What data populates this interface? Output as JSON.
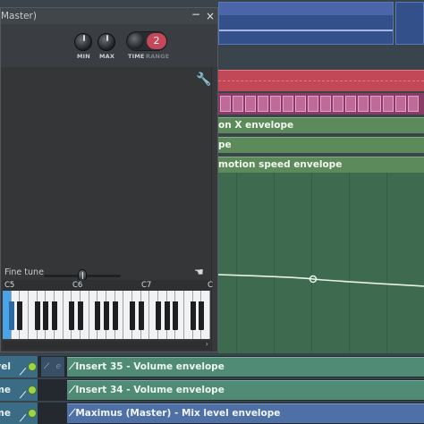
{
  "plugin": {
    "title": "Master)",
    "minimize_symbol": "−",
    "close_symbol": "×",
    "knobs": {
      "min_label": "MIN",
      "max_label": "MAX",
      "time_label": "TIME",
      "range_label": "RANGE",
      "time_value": "2"
    },
    "settings_icon": "wrench-icon",
    "fine_tune_label": "Fine tune",
    "keyboard": {
      "octave_labels": [
        "C5",
        "C6",
        "C7",
        "C"
      ],
      "highlighted_key": "C5"
    }
  },
  "playlist": {
    "envelope_lanes": [
      "on X envelope",
      "pe",
      "motion speed envelope"
    ],
    "tracks": [
      {
        "header": "vel",
        "clip": "Insert 35 - Volume envelope",
        "mid_letter": "e"
      },
      {
        "header": "me",
        "clip": "Insert 34 - Volume envelope"
      },
      {
        "header": "ume",
        "clip": "Maximus (Master) - Mix level envelope"
      }
    ]
  },
  "colors": {
    "accent_red": "#c4475a",
    "envelope_green": "#5d8a5a",
    "clip_teal": "#4f8b75",
    "clip_blue": "#4f6fa7",
    "key_highlight": "#4aa3e6"
  }
}
